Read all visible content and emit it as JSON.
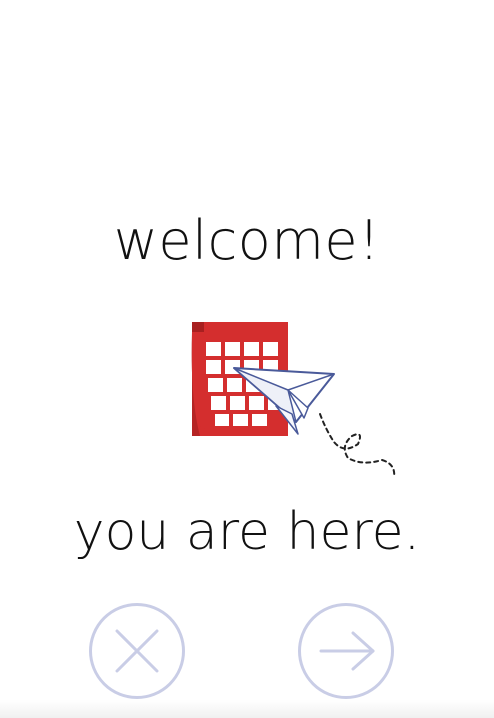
{
  "welcome_heading": "welcome!",
  "location_text": "you are here.",
  "illustration": {
    "calendar_icon": "calendar-icon",
    "plane_icon": "paper-plane-icon"
  },
  "buttons": {
    "close_icon": "close-icon",
    "next_icon": "arrow-right-icon"
  },
  "colors": {
    "calendar_red": "#d42e2e",
    "button_outline": "#c9cde6",
    "text": "#111111",
    "plane_outline": "#4a5a9a"
  }
}
